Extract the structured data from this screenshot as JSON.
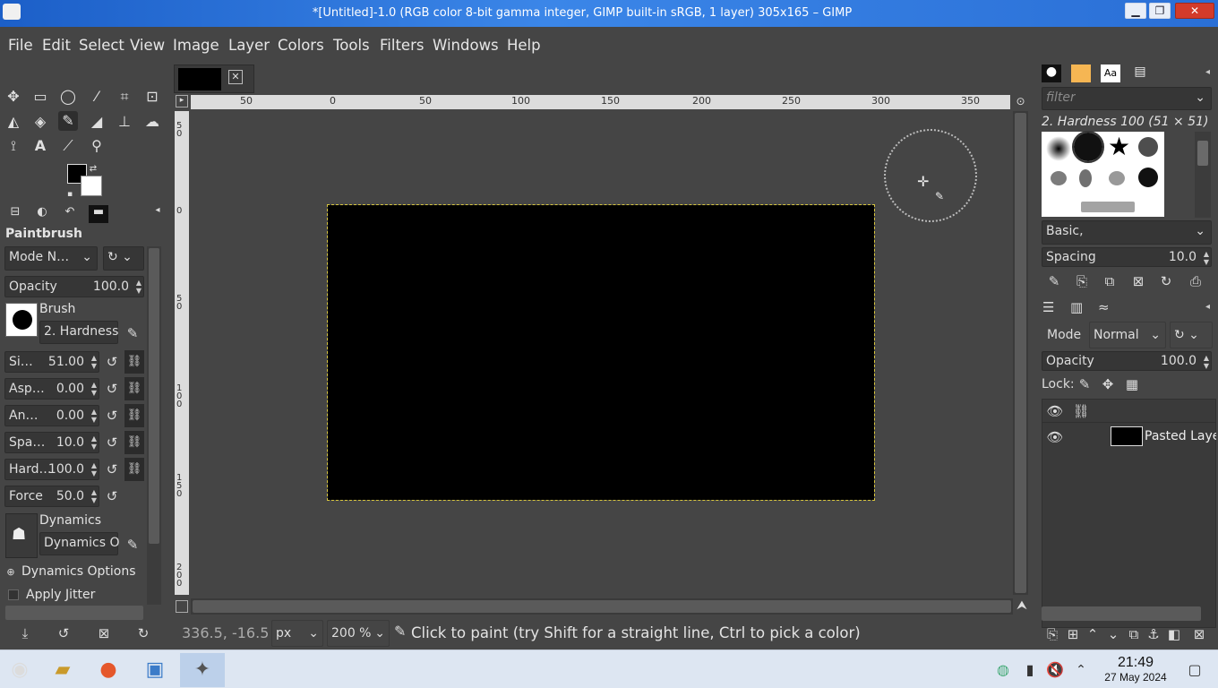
{
  "window": {
    "title": "*[Untitled]-1.0 (RGB color 8-bit gamma integer, GIMP built-in sRGB, 1 layer) 305x165 – GIMP",
    "min_label": "▁",
    "restore_label": "❐",
    "close_label": "✕"
  },
  "menu": [
    "File",
    "Edit",
    "Select",
    "View",
    "Image",
    "Layer",
    "Colors",
    "Tools",
    "Filters",
    "Windows",
    "Help"
  ],
  "tool_options": {
    "title": "Paintbrush",
    "mode": "Mode N…",
    "opacity_label": "Opacity",
    "opacity_value": "100.0",
    "brush_label": "Brush",
    "brush_name": "2. Hardness",
    "size_label": "Si…",
    "size_value": "51.00",
    "aspect_label": "Asp…",
    "aspect_value": "0.00",
    "angle_label": "An…",
    "angle_value": "0.00",
    "spacing_label": "Spa…",
    "spacing_value": "10.0",
    "hardness_label": "Hard…",
    "hardness_value": "100.0",
    "force_label": "Force",
    "force_value": "50.0",
    "dynamics_label": "Dynamics",
    "dynamics_name": "Dynamics O",
    "dynamics_options": "Dynamics Options",
    "apply_jitter": "Apply Jitter"
  },
  "rulers": {
    "h": [
      "50",
      "0",
      "50",
      "100",
      "150",
      "200",
      "250",
      "300",
      "350"
    ],
    "v": [
      "5 0",
      "0",
      "5 0",
      "1 0 0",
      "1 5 0",
      "2 0 0"
    ]
  },
  "status": {
    "coords": "336.5, -16.5",
    "unit": "px",
    "zoom": "200 %",
    "hint": "Click to paint (try Shift for a straight line, Ctrl to pick a color)"
  },
  "brushes": {
    "filter_placeholder": "filter",
    "selected": "2. Hardness 100 (51 × 51)",
    "tag": "Basic,",
    "spacing_label": "Spacing",
    "spacing_value": "10.0"
  },
  "layers": {
    "mode_label": "Mode",
    "mode_value": "Normal",
    "opacity_label": "Opacity",
    "opacity_value": "100.0",
    "lock_label": "Lock:",
    "layer_name": "Pasted Laye"
  },
  "taskbar": {
    "time": "21:49",
    "date": "27 May 2024"
  },
  "colors": {
    "foreground": "#000000",
    "background": "#ffffff",
    "selection_marching_ants": "#d8c63e"
  }
}
